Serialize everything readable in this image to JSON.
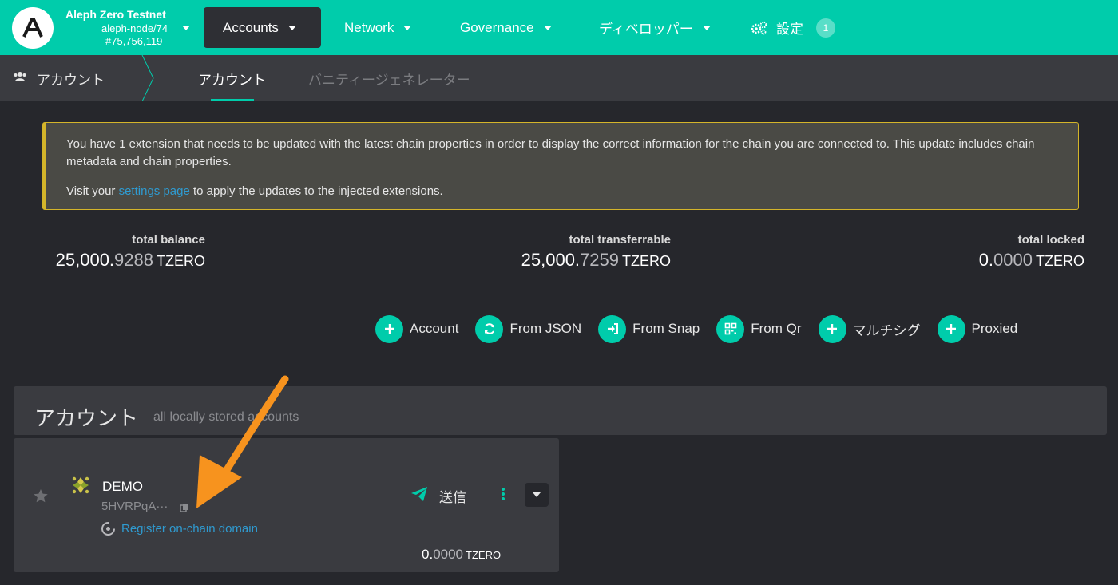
{
  "topbar": {
    "chain_name": "Aleph Zero Testnet",
    "node": "aleph-node/74",
    "block": "#75,756,119",
    "menu": [
      {
        "label": "Accounts",
        "active": true
      },
      {
        "label": "Network"
      },
      {
        "label": "Governance"
      },
      {
        "label": "ディベロッパー"
      },
      {
        "label": "設定",
        "badge": "1"
      }
    ]
  },
  "subnav": {
    "section": "アカウント",
    "tabs": [
      {
        "label": "アカウント",
        "active": true
      },
      {
        "label": "バニティージェネレーター"
      }
    ]
  },
  "warning": {
    "line1": "You have 1 extension that needs to be updated with the latest chain properties in order to display the correct information for the chain you are connected to. This update includes chain metadata and chain properties.",
    "line2_pre": "Visit your ",
    "line2_link": "settings page",
    "line2_post": " to apply the updates to the injected extensions."
  },
  "summary": {
    "total_balance": {
      "label": "total balance",
      "int": "25,000.",
      "dec": "9288",
      "unit": "TZERO"
    },
    "total_transferrable": {
      "label": "total transferrable",
      "int": "25,000.",
      "dec": "7259",
      "unit": "TZERO"
    },
    "total_locked": {
      "label": "total locked",
      "int": "0.",
      "dec": "0000",
      "unit": "TZERO"
    }
  },
  "actions": [
    {
      "label": "Account",
      "icon": "plus-icon"
    },
    {
      "label": "From JSON",
      "icon": "sync-icon"
    },
    {
      "label": "From Snap",
      "icon": "sign-in-icon"
    },
    {
      "label": "From Qr",
      "icon": "qrcode-icon"
    },
    {
      "label": "マルチシグ",
      "icon": "plus-icon"
    },
    {
      "label": "Proxied",
      "icon": "plus-icon"
    }
  ],
  "accounts_section": {
    "title": "アカウント",
    "subtitle": "all locally stored accounts"
  },
  "account": {
    "name": "DEMO",
    "address": "5HVRPqA···",
    "register_link": "Register on-chain domain",
    "send_label": "送信",
    "balance_int": "0.",
    "balance_dec": "0000",
    "balance_unit": "TZERO"
  },
  "colors": {
    "accent": "#00ccab",
    "warning_border": "#d4b52a",
    "link": "#2f9bd1",
    "annotation_arrow": "#f7931e"
  }
}
